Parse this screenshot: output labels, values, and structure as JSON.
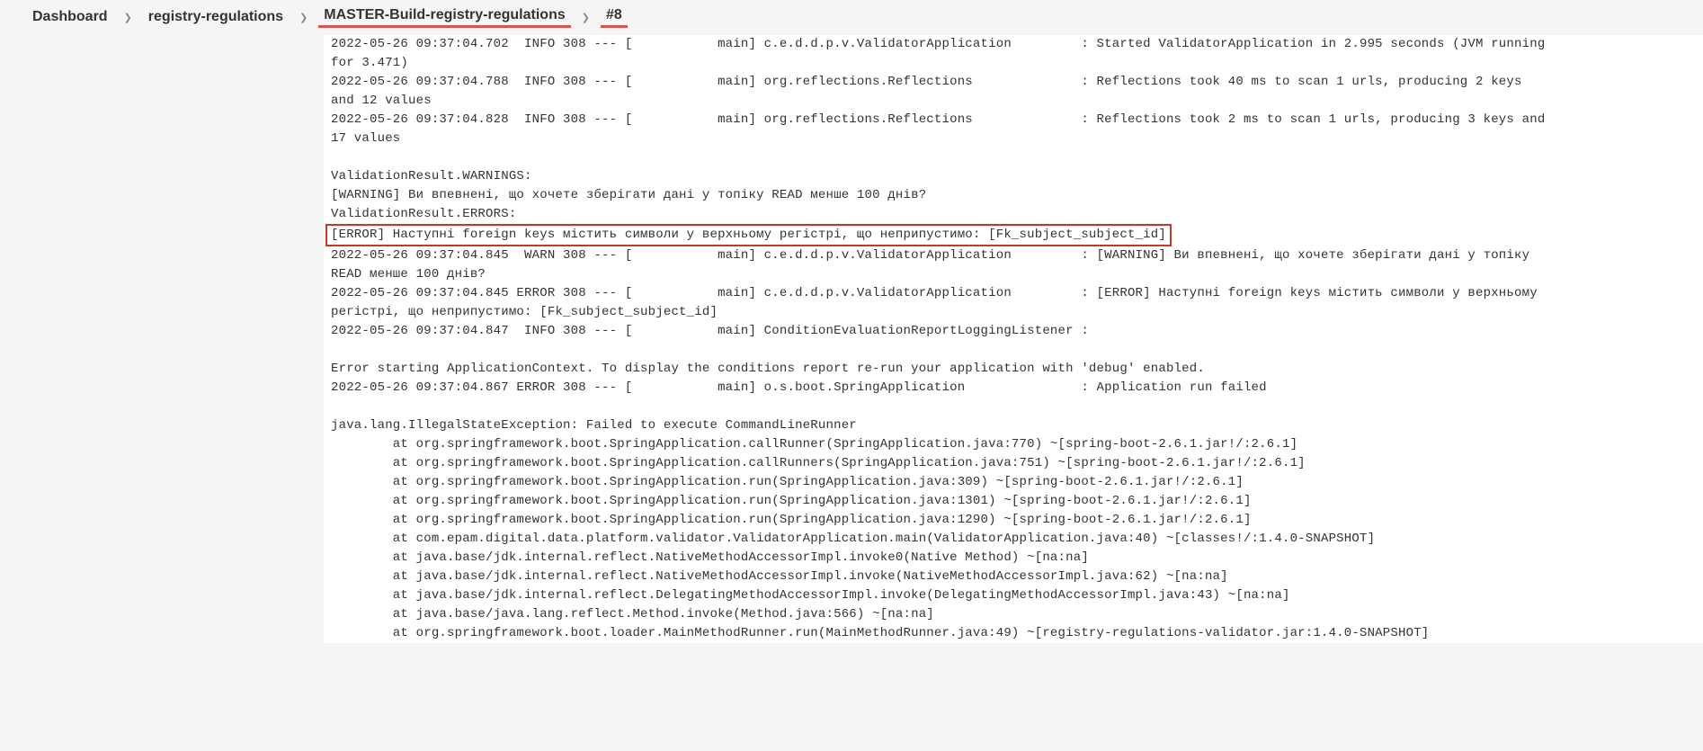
{
  "breadcrumb": {
    "items": [
      {
        "label": "Dashboard",
        "underline": false
      },
      {
        "label": "registry-regulations",
        "underline": false
      },
      {
        "label": "MASTER-Build-registry-regulations",
        "underline": true
      },
      {
        "label": "#8",
        "underline": true
      }
    ]
  },
  "log": {
    "lines": [
      {
        "text": "2022-05-26 09:37:04.702  INFO 308 --- [           main] c.e.d.d.p.v.ValidatorApplication         : Started ValidatorApplication in 2.995 seconds (JVM running"
      },
      {
        "text": "for 3.471)"
      },
      {
        "text": "2022-05-26 09:37:04.788  INFO 308 --- [           main] org.reflections.Reflections              : Reflections took 40 ms to scan 1 urls, producing 2 keys"
      },
      {
        "text": "and 12 values"
      },
      {
        "text": "2022-05-26 09:37:04.828  INFO 308 --- [           main] org.reflections.Reflections              : Reflections took 2 ms to scan 1 urls, producing 3 keys and"
      },
      {
        "text": "17 values"
      },
      {
        "text": ""
      },
      {
        "text": "ValidationResult.WARNINGS:"
      },
      {
        "text": "[WARNING] Ви впевнені, що хочете зберігати дані у топіку READ менше 100 днів?"
      },
      {
        "text": "ValidationResult.ERRORS:"
      },
      {
        "text": "[ERROR] Наступні foreign keys містить символи у верхньому регістрі, що неприпустимо: [Fk_subject_subject_id]",
        "highlight": true
      },
      {
        "text": "2022-05-26 09:37:04.845  WARN 308 --- [           main] c.e.d.d.p.v.ValidatorApplication         : [WARNING] Ви впевнені, що хочете зберігати дані у топіку"
      },
      {
        "text": "READ менше 100 днів?"
      },
      {
        "text": "2022-05-26 09:37:04.845 ERROR 308 --- [           main] c.e.d.d.p.v.ValidatorApplication         : [ERROR] Наступні foreign keys містить символи у верхньому"
      },
      {
        "text": "регістрі, що неприпустимо: [Fk_subject_subject_id]"
      },
      {
        "text": "2022-05-26 09:37:04.847  INFO 308 --- [           main] ConditionEvaluationReportLoggingListener :"
      },
      {
        "text": ""
      },
      {
        "text": "Error starting ApplicationContext. To display the conditions report re-run your application with 'debug' enabled."
      },
      {
        "text": "2022-05-26 09:37:04.867 ERROR 308 --- [           main] o.s.boot.SpringApplication               : Application run failed"
      },
      {
        "text": ""
      },
      {
        "text": "java.lang.IllegalStateException: Failed to execute CommandLineRunner"
      },
      {
        "text": "        at org.springframework.boot.SpringApplication.callRunner(SpringApplication.java:770) ~[spring-boot-2.6.1.jar!/:2.6.1]"
      },
      {
        "text": "        at org.springframework.boot.SpringApplication.callRunners(SpringApplication.java:751) ~[spring-boot-2.6.1.jar!/:2.6.1]"
      },
      {
        "text": "        at org.springframework.boot.SpringApplication.run(SpringApplication.java:309) ~[spring-boot-2.6.1.jar!/:2.6.1]"
      },
      {
        "text": "        at org.springframework.boot.SpringApplication.run(SpringApplication.java:1301) ~[spring-boot-2.6.1.jar!/:2.6.1]"
      },
      {
        "text": "        at org.springframework.boot.SpringApplication.run(SpringApplication.java:1290) ~[spring-boot-2.6.1.jar!/:2.6.1]"
      },
      {
        "text": "        at com.epam.digital.data.platform.validator.ValidatorApplication.main(ValidatorApplication.java:40) ~[classes!/:1.4.0-SNAPSHOT]"
      },
      {
        "text": "        at java.base/jdk.internal.reflect.NativeMethodAccessorImpl.invoke0(Native Method) ~[na:na]"
      },
      {
        "text": "        at java.base/jdk.internal.reflect.NativeMethodAccessorImpl.invoke(NativeMethodAccessorImpl.java:62) ~[na:na]"
      },
      {
        "text": "        at java.base/jdk.internal.reflect.DelegatingMethodAccessorImpl.invoke(DelegatingMethodAccessorImpl.java:43) ~[na:na]"
      },
      {
        "text": "        at java.base/java.lang.reflect.Method.invoke(Method.java:566) ~[na:na]"
      },
      {
        "text": "        at org.springframework.boot.loader.MainMethodRunner.run(MainMethodRunner.java:49) ~[registry-regulations-validator.jar:1.4.0-SNAPSHOT]"
      }
    ]
  }
}
